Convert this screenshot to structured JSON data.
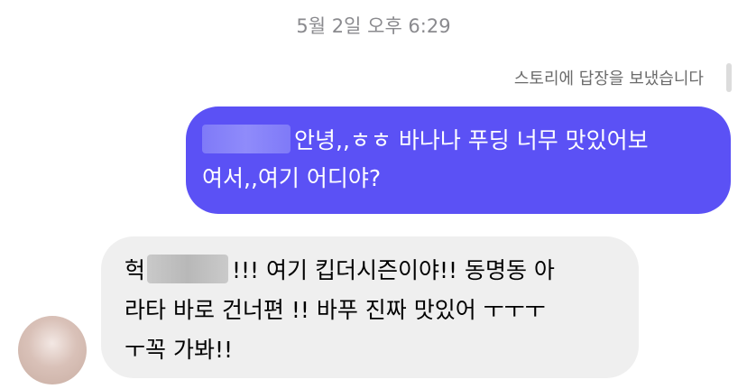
{
  "timestamp": "5월 2일 오후 6:29",
  "reply_note": "스토리에 답장을 보냈습니다",
  "outgoing": {
    "line1": "안녕,,ㅎㅎ 바나나 푸딩 너무 맛있어보",
    "line2": "여서,,여기 어디야?"
  },
  "incoming": {
    "line1_prefix": "헉",
    "line1_suffix": "!!! 여기 킵더시즌이야!! 동명동 아",
    "line2": "라타 바로 건너편 !! 바푸 진짜 맛있어 ㅜㅜㅜ",
    "line3": "ㅜ꼭 가봐!!"
  }
}
